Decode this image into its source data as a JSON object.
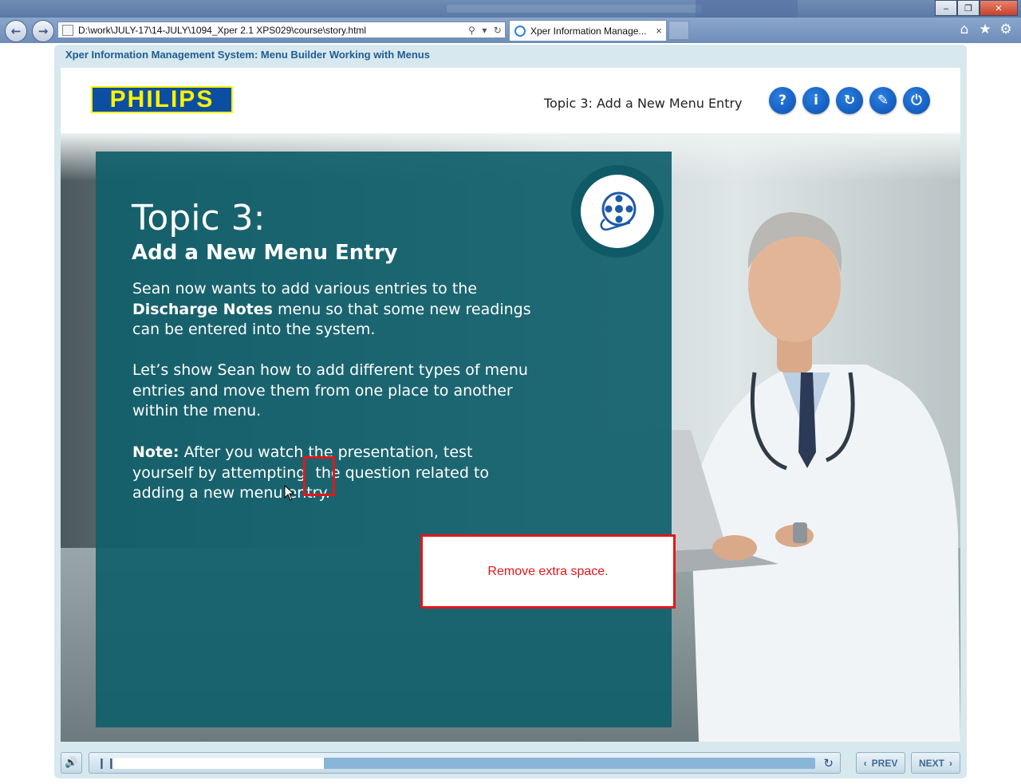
{
  "browser": {
    "address_url": "D:\\work\\JULY-17\\14-JULY\\1094_Xper 2.1 XPS029\\course\\story.html",
    "tab_title": "Xper Information Manage...",
    "tab_close": "×",
    "back_icon": "back-arrow-icon",
    "forward_icon": "forward-arrow-icon",
    "window_controls": {
      "minimize": "‒",
      "restore": "❐",
      "close": "✕"
    },
    "toolbar_icons": [
      "home-icon",
      "star-icon",
      "gear-icon"
    ]
  },
  "course": {
    "title": "Xper Information Management System: Menu Builder Working with Menus"
  },
  "header": {
    "logo_text": "PHILIPS",
    "topic_label": "Topic 3: Add a New Menu Entry",
    "buttons": [
      {
        "label": "?",
        "icon": "help-icon"
      },
      {
        "label": "i",
        "icon": "info-icon"
      },
      {
        "label": "↻",
        "icon": "restart-icon"
      },
      {
        "label": "✎",
        "icon": "glossary-icon"
      },
      {
        "label": "⏻",
        "icon": "exit-icon"
      }
    ]
  },
  "slide": {
    "heading": "Topic 3:",
    "subheading": "Add a New Menu Entry",
    "para1_a": "Sean now wants to add various entries to the ",
    "para1_bold": "Discharge Notes",
    "para1_b": " menu so that some new readings can be entered into the system.",
    "para2": "Let’s show Sean how to add different types of menu entries and move them from one place to another within the menu.",
    "note_label": "Note:",
    "note_text": " After you watch the presentation, test yourself by attempting  the question related to adding a new menu entry.",
    "video_icon": "film-reel-icon"
  },
  "annotation": {
    "callout_text": "Remove extra space.",
    "color": "#e2171b"
  },
  "controls": {
    "progress": 0.3,
    "prev_label": "PREV",
    "next_label": "NEXT",
    "volume_icon": "speaker-icon",
    "pause_icon": "pause-icon",
    "replay_icon": "replay-icon"
  },
  "colors": {
    "panel": "#11606c",
    "accent_blue": "#0b4fb0",
    "title_blue": "#1f5c93"
  }
}
